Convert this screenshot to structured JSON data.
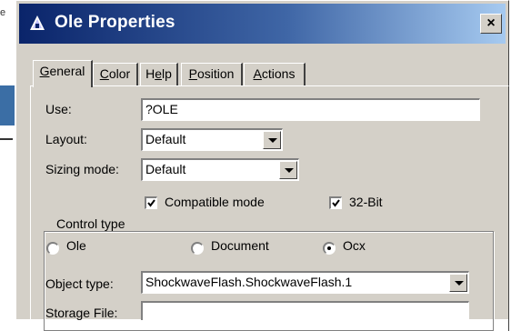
{
  "background": {
    "left_fragment": "e",
    "right_fragment": "t"
  },
  "window": {
    "title": "Ole Properties",
    "close_label": "×"
  },
  "tabs": [
    {
      "pre": "",
      "key": "G",
      "post": "eneral"
    },
    {
      "pre": "",
      "key": "C",
      "post": "olor"
    },
    {
      "pre": "H",
      "key": "e",
      "post": "lp"
    },
    {
      "pre": "",
      "key": "P",
      "post": "osition"
    },
    {
      "pre": "",
      "key": "A",
      "post": "ctions"
    }
  ],
  "general": {
    "use": {
      "label": "Use:",
      "value": "?OLE"
    },
    "layout": {
      "label": "Layout:",
      "value": "Default"
    },
    "sizing_mode": {
      "label": "Sizing mode:",
      "value": "Default"
    },
    "compatible_mode": {
      "label": "Compatible mode",
      "checked": true
    },
    "bit32": {
      "label": "32-Bit",
      "checked": true
    },
    "control_type": {
      "legend": "Control type",
      "options": [
        "Ole",
        "Document",
        "Ocx"
      ],
      "selected": "Ocx"
    },
    "object_type": {
      "label": "Object type:",
      "value": "ShockwaveFlash.ShockwaveFlash.1"
    },
    "storage_file": {
      "label": "Storage File:",
      "value": ""
    }
  },
  "icons": {
    "app_icon": "ole-app-icon",
    "close_icon": "close-icon",
    "dropdown_icon": "chevron-down-icon",
    "check_icon": "checkmark-icon"
  },
  "colors": {
    "title_start": "#0a246a",
    "title_end": "#a6caf0",
    "face": "#d4d0c8"
  }
}
